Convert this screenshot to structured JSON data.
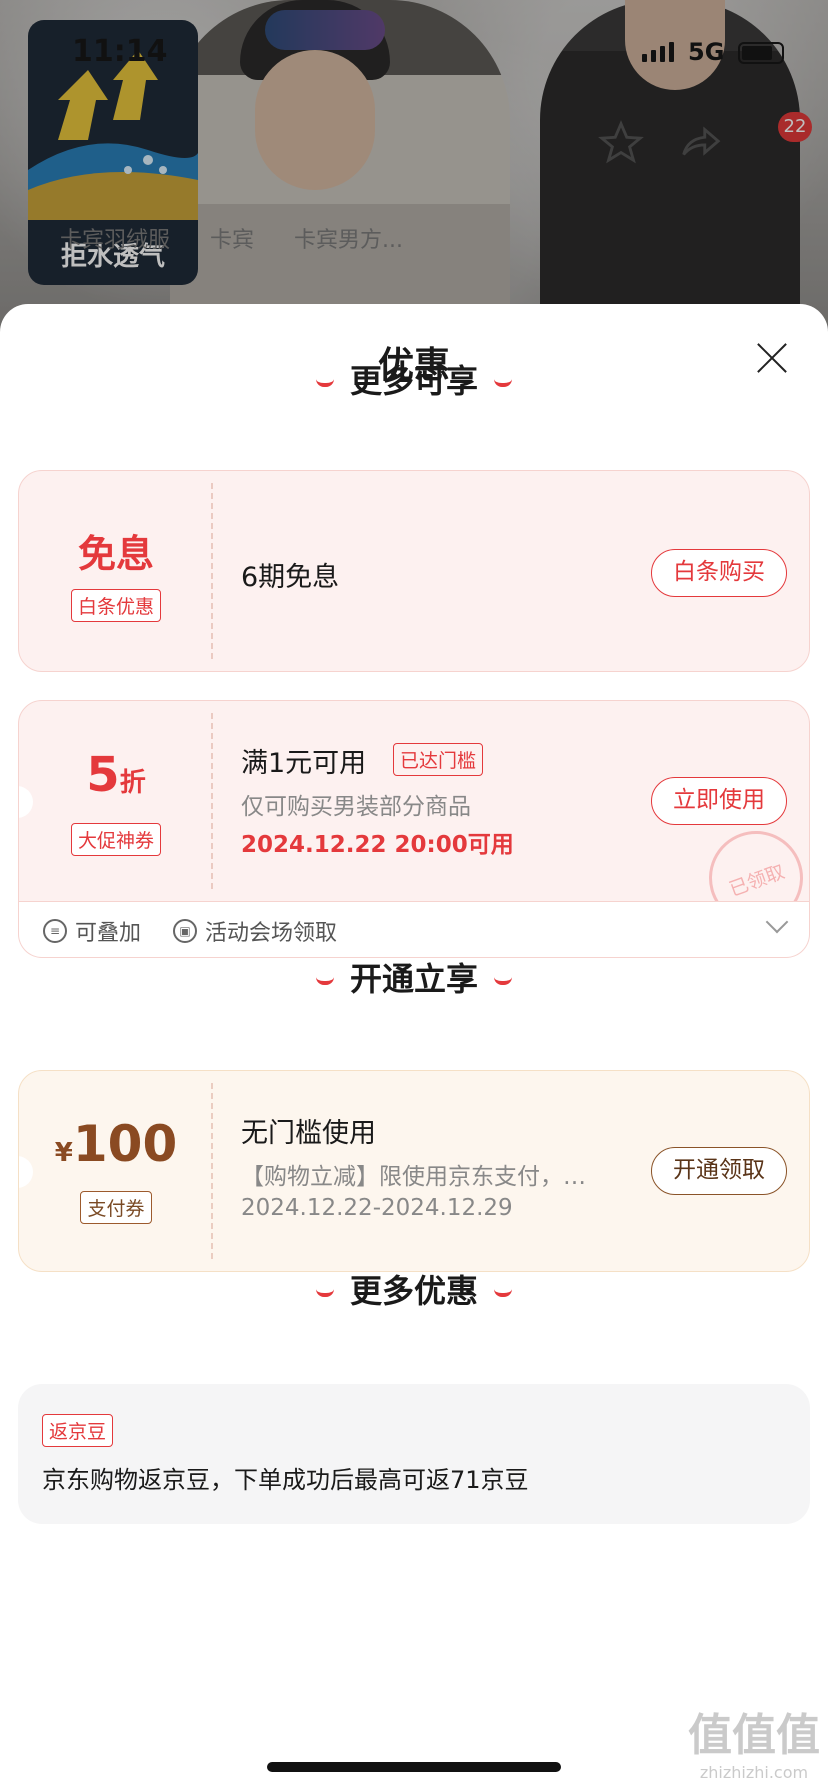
{
  "status_bar": {
    "time": "11:14",
    "network": "5G"
  },
  "background": {
    "feature_label": "拒水透气",
    "cart_count": "22",
    "tabs": [
      "卡宾羽绒服",
      "卡宾",
      "卡宾男方..."
    ]
  },
  "sheet": {
    "title": "优惠",
    "sections": {
      "more_enjoy": "更多可享",
      "open_enjoy": "开通立享",
      "more_offers": "更多优惠"
    },
    "card_interest_free": {
      "big": "免息",
      "tag": "白条优惠",
      "main": "6期免息",
      "button": "白条购买"
    },
    "card_discount": {
      "value": "5",
      "unit": "折",
      "tag": "大促神券",
      "main": "满1元可用",
      "reached_tag": "已达门槛",
      "sub": "仅可购买男装部分商品",
      "time": "2024.12.22 20:00可用",
      "button": "立即使用",
      "stamp": "已领取",
      "foot_stackable": "可叠加",
      "foot_venue": "活动会场领取"
    },
    "card_pay": {
      "currency": "¥",
      "value": "100",
      "tag": "支付券",
      "main": "无门槛使用",
      "sub": "【购物立减】限使用京东支付，…",
      "time": "2024.12.22-2024.12.29",
      "button": "开通领取"
    },
    "card_jingdou": {
      "tag": "返京豆",
      "text": "京东购物返京豆，下单成功后最高可返71京豆"
    }
  },
  "watermark": {
    "main": "值值值",
    "sub": "zhizhizhi.com"
  },
  "colors": {
    "accent": "#e4393c",
    "gold_text": "#8a5328",
    "sheet_bg": "#ffffff"
  }
}
